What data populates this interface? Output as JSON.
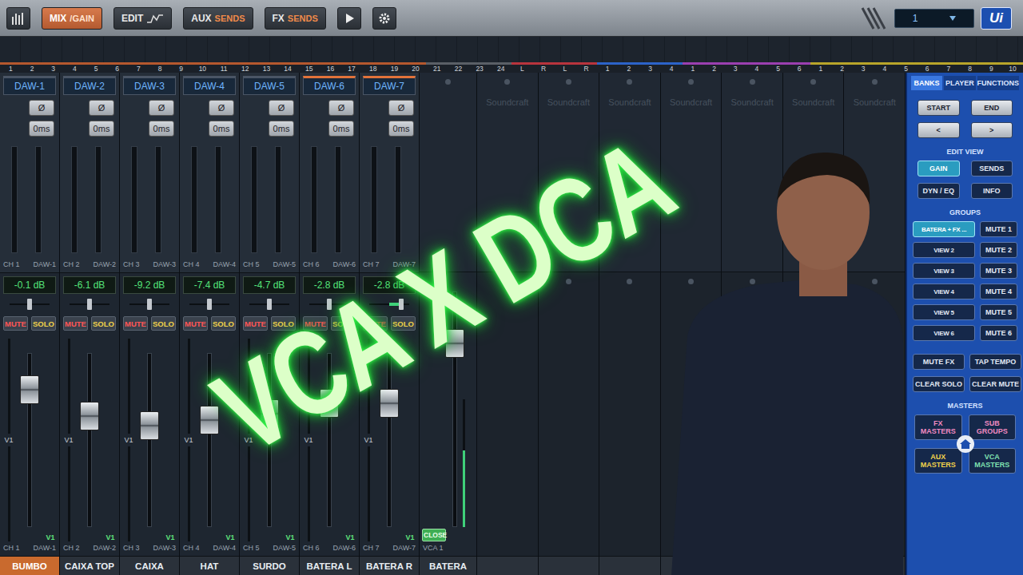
{
  "toolbar": {
    "buttons": [
      {
        "main": "MIX",
        "sub": "/GAIN",
        "kind": "text",
        "selected": true
      },
      {
        "main": "EDIT",
        "kind": "edit",
        "selected": false
      },
      {
        "main": "AUX",
        "sub": "SENDS",
        "kind": "text",
        "selected": false
      },
      {
        "main": "FX",
        "sub": "SENDS",
        "kind": "text",
        "selected": false
      }
    ],
    "display": "1",
    "logo": "Ui"
  },
  "channel_numbers": [
    {
      "numbers": [
        "1",
        "2",
        "3",
        "4",
        "5",
        "6",
        "7",
        "8",
        "9",
        "10",
        "11",
        "12",
        "13",
        "14",
        "15",
        "16",
        "17",
        "18",
        "19",
        "20"
      ],
      "color": "#b5582e"
    },
    {
      "numbers": [
        "21",
        "22",
        "23",
        "24"
      ],
      "color": "#5a5f66"
    },
    {
      "numbers": [
        "L",
        "R",
        "L",
        "R"
      ],
      "color": "#b8343d"
    },
    {
      "numbers": [
        "1",
        "2",
        "3",
        "4"
      ],
      "color": "#2c63c9"
    },
    {
      "numbers": [
        "1",
        "2",
        "3",
        "4",
        "5",
        "6"
      ],
      "color": "#9b3fb0"
    },
    {
      "numbers": [
        "1",
        "2",
        "3",
        "4",
        "5",
        "6",
        "7",
        "8",
        "9",
        "10"
      ],
      "color": "#b9a52a"
    }
  ],
  "channels": [
    {
      "name": "DAW-1",
      "ch": "CH 1",
      "phase": "Ø",
      "delay": "0ms",
      "reading": "-0.1 dB",
      "mute": "MUTE",
      "solo": "SOLO",
      "muted": false,
      "soloed": false,
      "vca": "V1",
      "level": 0.75,
      "pan": 0.5,
      "linked": false,
      "label": "BUMBO",
      "selected": true
    },
    {
      "name": "DAW-2",
      "ch": "CH 2",
      "phase": "Ø",
      "delay": "0ms",
      "reading": "-6.1 dB",
      "mute": "MUTE",
      "solo": "SOLO",
      "muted": false,
      "soloed": false,
      "vca": "V1",
      "level": 0.62,
      "pan": 0.5,
      "linked": false,
      "label": "CAIXA TOP",
      "selected": false
    },
    {
      "name": "DAW-3",
      "ch": "CH 3",
      "phase": "Ø",
      "delay": "0ms",
      "reading": "-9.2 dB",
      "mute": "MUTE",
      "solo": "SOLO",
      "muted": false,
      "soloed": false,
      "vca": "V1",
      "level": 0.57,
      "pan": 0.5,
      "linked": false,
      "label": "CAIXA",
      "selected": false
    },
    {
      "name": "DAW-4",
      "ch": "CH 4",
      "phase": "Ø",
      "delay": "0ms",
      "reading": "-7.4 dB",
      "mute": "MUTE",
      "solo": "SOLO",
      "muted": false,
      "soloed": false,
      "vca": "V1",
      "level": 0.6,
      "pan": 0.5,
      "linked": false,
      "label": "HAT",
      "selected": false
    },
    {
      "name": "DAW-5",
      "ch": "CH 5",
      "phase": "Ø",
      "delay": "0ms",
      "reading": "-4.7 dB",
      "mute": "MUTE",
      "solo": "SOLO",
      "muted": false,
      "soloed": false,
      "vca": "V1",
      "level": 0.63,
      "pan": 0.5,
      "linked": false,
      "label": "SURDO",
      "selected": false
    },
    {
      "name": "DAW-6",
      "ch": "CH 6",
      "phase": "Ø",
      "delay": "0ms",
      "reading": "-2.8 dB",
      "mute": "MUTE",
      "solo": "SOLO",
      "muted": false,
      "soloed": false,
      "vca": "V1",
      "level": 0.68,
      "pan": 0.5,
      "linked": true,
      "label": "BATERA L",
      "selected": false
    },
    {
      "name": "DAW-7",
      "ch": "CH 7",
      "phase": "Ø",
      "delay": "0ms",
      "reading": "-2.8 dB",
      "mute": "MUTE",
      "solo": "SOLO",
      "muted": false,
      "soloed": false,
      "vca": "V1",
      "level": 0.68,
      "pan": 0.8,
      "linked": true,
      "label": "BATERA R",
      "selected": false
    }
  ],
  "vca_strip": {
    "ch": "VCA 1",
    "close": "CLOSE",
    "level": 0.75,
    "meter": 0.6,
    "label": "BATERA"
  },
  "empty_strips": [
    {
      "watermark": "Soundcraft"
    },
    {
      "watermark": "Soundcraft"
    },
    {
      "watermark": "Soundcraft"
    },
    {
      "watermark": "Soundcraft"
    },
    {
      "watermark": "Soundcraft"
    },
    {
      "watermark": "Soundcraft"
    },
    {
      "watermark": "Soundcraft"
    }
  ],
  "right_panel": {
    "tabs": [
      {
        "label": "BANKS",
        "selected": true
      },
      {
        "label": "PLAYER",
        "selected": false
      },
      {
        "label": "FUNCTIONS",
        "selected": false
      }
    ],
    "nav": [
      "START",
      "END",
      "<",
      ">"
    ],
    "edit_view": {
      "title": "EDIT VIEW",
      "buttons": [
        {
          "label": "GAIN",
          "selected": true
        },
        {
          "label": "SENDS",
          "selected": false
        },
        {
          "label": "DYN / EQ",
          "selected": false
        },
        {
          "label": "INFO",
          "selected": false
        }
      ]
    },
    "groups": {
      "title": "GROUPS",
      "rows": [
        {
          "view": {
            "label": "BATERA + FX ...",
            "selected": true
          },
          "mute": {
            "label": "MUTE 1",
            "selected": false
          }
        },
        {
          "view": {
            "label": "VIEW 2",
            "selected": false
          },
          "mute": {
            "label": "MUTE 2",
            "selected": false
          }
        },
        {
          "view": {
            "label": "VIEW 3",
            "selected": false
          },
          "mute": {
            "label": "MUTE 3",
            "selected": false
          }
        },
        {
          "view": {
            "label": "VIEW 4",
            "selected": false
          },
          "mute": {
            "label": "MUTE 4",
            "selected": false
          }
        },
        {
          "view": {
            "label": "VIEW 5",
            "selected": false
          },
          "mute": {
            "label": "MUTE 5",
            "selected": false
          }
        },
        {
          "view": {
            "label": "VIEW 6",
            "selected": false
          },
          "mute": {
            "label": "MUTE 6",
            "selected": false
          }
        }
      ]
    },
    "functions": [
      "MUTE FX",
      "TAP TEMPO",
      "CLEAR SOLO",
      "CLEAR MUTE"
    ],
    "masters": {
      "title": "MASTERS",
      "buttons": [
        {
          "label": "FX MASTERS",
          "color": "#f08ac0"
        },
        {
          "label": "SUB GROUPS",
          "color": "#f08ac0"
        },
        {
          "label": "AUX MASTERS",
          "color": "#f0d24a"
        },
        {
          "label": "VCA MASTERS",
          "color": "#7fe0b0"
        }
      ]
    }
  },
  "overlay": {
    "title": "VCA X DCA"
  }
}
